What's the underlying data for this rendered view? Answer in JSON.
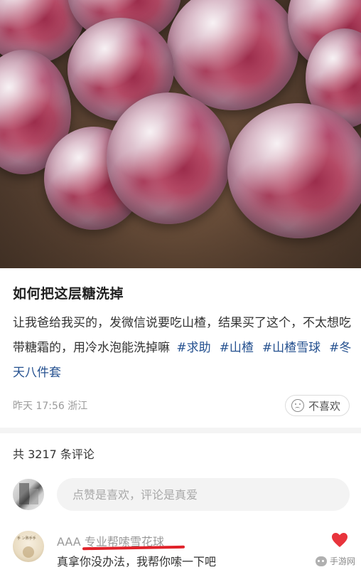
{
  "post": {
    "title": "如何把这层糖洗掉",
    "body_text": "让我爸给我买的，发微信说要吃山楂，结果买了这个，不太想吃带糖霜的，用冷水泡能洗掉嘛",
    "tags": [
      "#求助",
      "#山楂",
      "#山楂雪球",
      "#冬天八件套"
    ],
    "meta": "昨天 17:56 浙江",
    "dislike_label": "不喜欢"
  },
  "comments": {
    "count_label": "共 3217 条评论",
    "input_placeholder": "点赞是喜欢，评论是真爱",
    "items": [
      {
        "username": "AAA 专业帮嗦雪花球",
        "text": "真拿你没办法，我帮你嗦一下吧",
        "liked": true,
        "like_color": "#e8343c",
        "avatar_caption": "手 ン熟手手"
      }
    ]
  },
  "watermark": {
    "label": "手游网"
  },
  "colors": {
    "tag": "#24508f",
    "highlight_underline": "#e0222a"
  }
}
